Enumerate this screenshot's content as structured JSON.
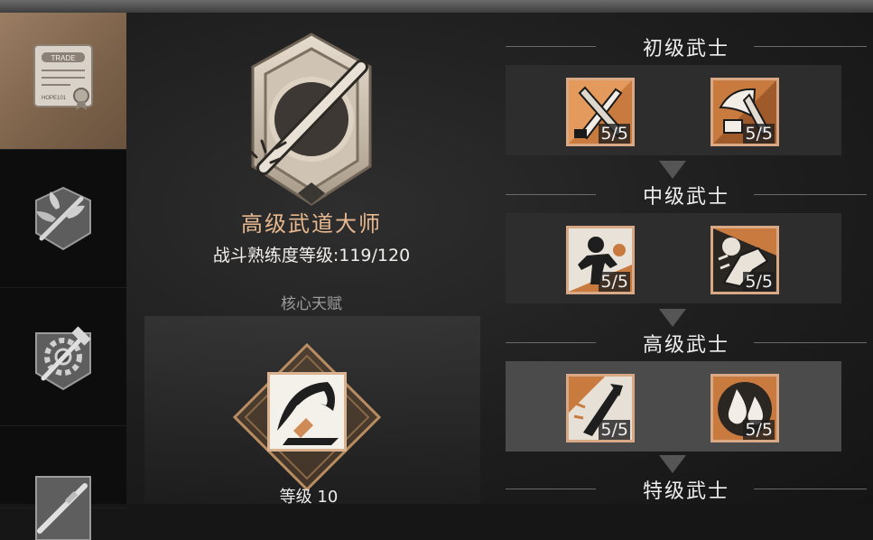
{
  "sidebar": {
    "tabs": [
      {
        "icon": "trade-certificate-icon",
        "badge_text": "TRADE",
        "sub_text": "HOPE101",
        "active": true
      },
      {
        "icon": "plant-emblem-icon",
        "active": false
      },
      {
        "icon": "gear-hammer-icon",
        "active": false
      },
      {
        "icon": "rifle-emblem-icon",
        "active": false
      }
    ]
  },
  "mastery": {
    "emblem_icon": "spiked-bat-emblem-icon",
    "title": "高级武道大师",
    "level_text": "战斗熟练度等级:119/120"
  },
  "core_talent": {
    "label": "核心天赋",
    "icon": "sweeping-blade-icon",
    "level_text": "等级 10"
  },
  "tiers": [
    {
      "name": "初级武士",
      "talents": [
        {
          "icon": "crossed-blades-icon",
          "count": "5/5"
        },
        {
          "icon": "cleaver-icon",
          "count": "5/5"
        }
      ]
    },
    {
      "name": "中级武士",
      "talents": [
        {
          "icon": "fighter-stance-icon",
          "count": "5/5"
        },
        {
          "icon": "punch-impact-icon",
          "count": "5/5"
        }
      ]
    },
    {
      "name": "高级武士",
      "talents": [
        {
          "icon": "falling-blade-icon",
          "count": "5/5"
        },
        {
          "icon": "droplets-icon",
          "count": "5/5"
        }
      ]
    },
    {
      "name": "特级武士",
      "talents": []
    }
  ],
  "colors": {
    "accent": "#e7b88f",
    "frame": "#d8a984",
    "active_tab": "#8d7158"
  }
}
